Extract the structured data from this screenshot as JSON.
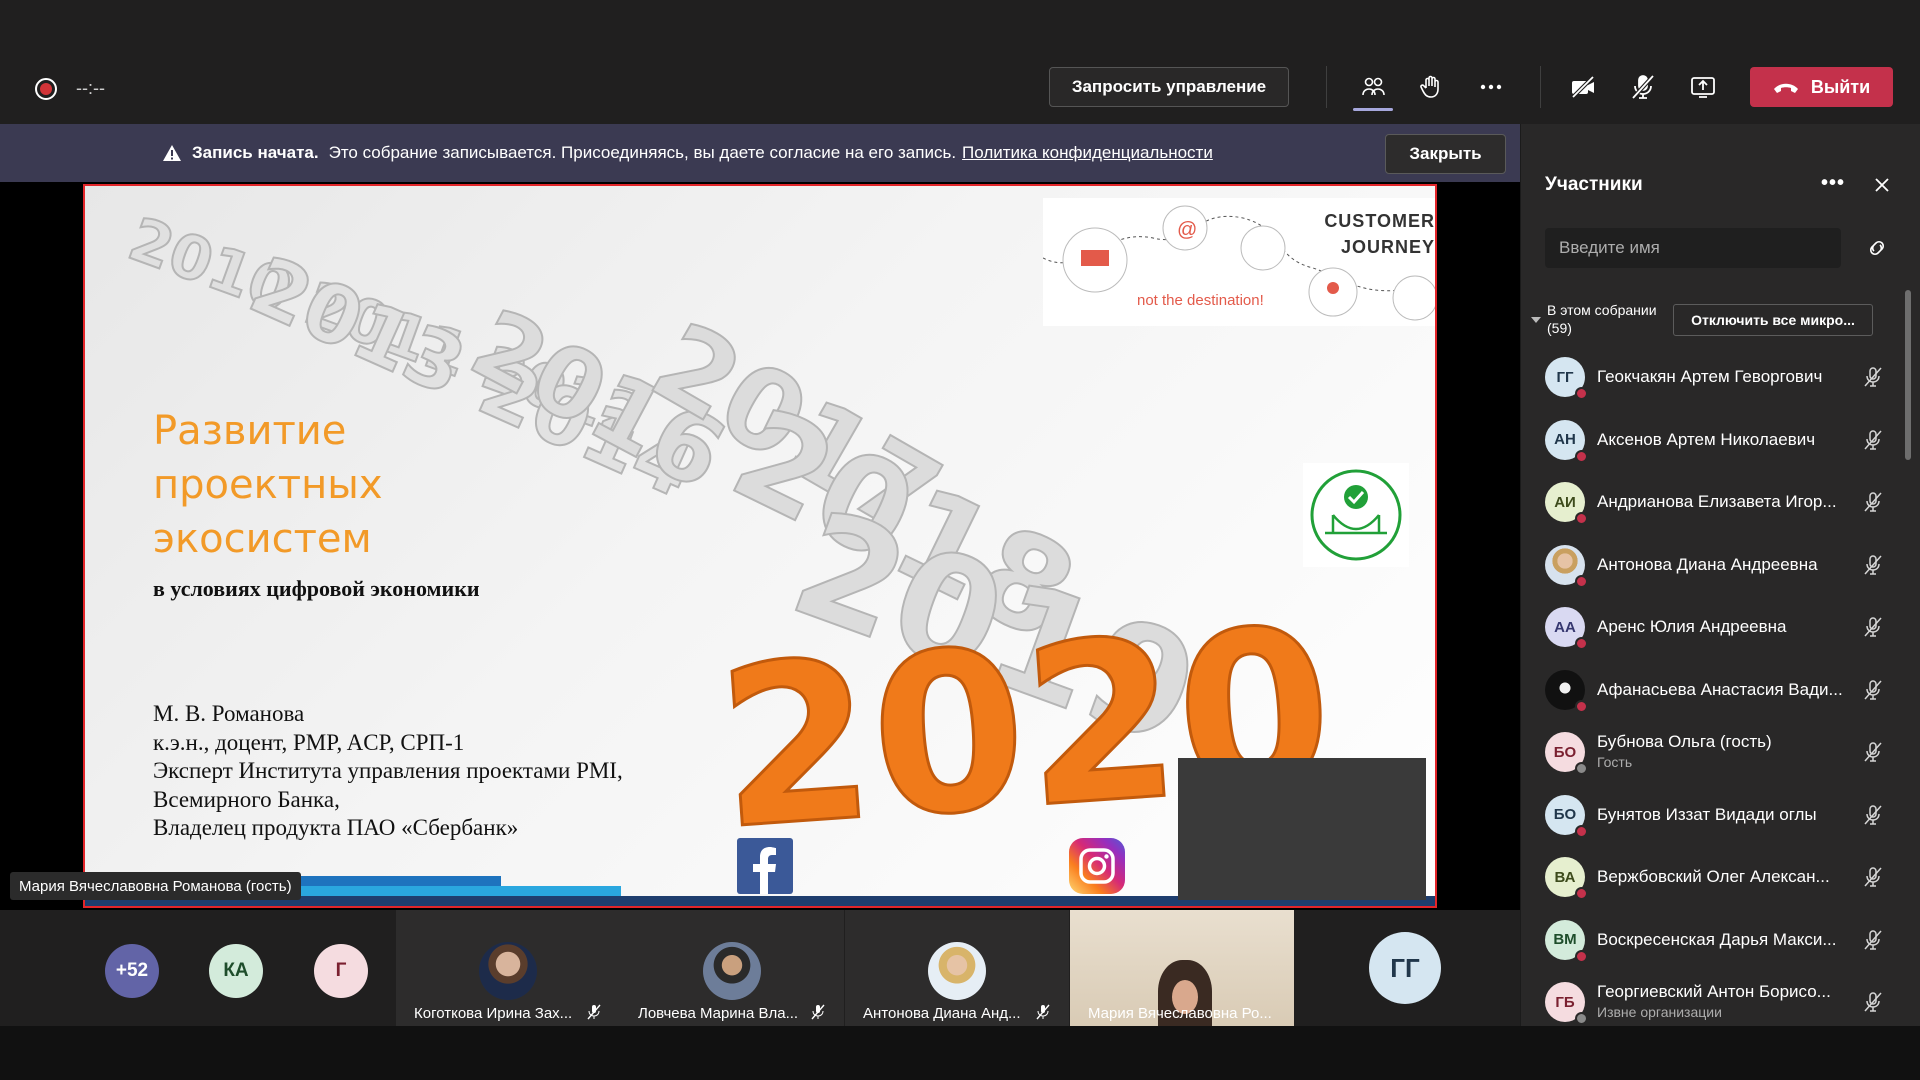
{
  "topbar": {
    "timer": "--:--",
    "request_control_label": "Запросить управление",
    "leave_label": "Выйти"
  },
  "banner": {
    "bold": "Запись начата.",
    "text": "Это собрание записывается. Присоединяясь, вы даете согласие на его запись.",
    "link": "Политика конфиденциальности",
    "close_label": "Закрыть"
  },
  "slide": {
    "title": "Развитие проектных экосистем",
    "subtitle": "в условиях цифровой экономики",
    "author_lines": "М. В. Романова\nк.э.н., доцент, PMP, ACP, СРП-1\nЭксперт Института управления проектами PMI,\nВсемирного Банка,\nВладелец продукта ПАО «Сбербанк»",
    "cj_title_1": "CUSTOMER",
    "cj_title_2": "JOURNEY",
    "cj_sub": "not the destination!",
    "years": [
      "2020",
      "2019",
      "2018",
      "2017",
      "2016"
    ]
  },
  "presenter_label": "Мария Вячеславовна Романова (гость)",
  "strip": {
    "bubbles": [
      {
        "label": "+52",
        "bg": "#6264a7",
        "fg": "#ffffff"
      },
      {
        "label": "КА",
        "bg": "#d3ebdb",
        "fg": "#1e4d2b"
      },
      {
        "label": "Г",
        "bg": "#f5dce0",
        "fg": "#7a2030"
      }
    ],
    "tiles": [
      {
        "name": "Коготкова Ирина Зах..."
      },
      {
        "name": "Ловчева Марина Вла..."
      },
      {
        "name": "Антонова Диана Анд..."
      }
    ],
    "video_name": "Мария Вячеславовна Ро...",
    "gg_label": "ГГ"
  },
  "panel": {
    "title": "Участники",
    "search_placeholder": "Введите имя",
    "section_label": "В этом собрании (59)",
    "mute_all_label": "Отключить все микро...",
    "participants": [
      {
        "initials": "ГГ",
        "name": "Геокчакян Артем Геворгович",
        "sub": "",
        "bg": "#d5e6f1",
        "fg": "#21374b",
        "status": "#c4314b"
      },
      {
        "initials": "АН",
        "name": "Аксенов Артем Николаевич",
        "sub": "",
        "bg": "#d5e6f1",
        "fg": "#21374b",
        "status": "#c4314b"
      },
      {
        "initials": "АИ",
        "name": "Андрианова Елизавета Игор...",
        "sub": "",
        "bg": "#e6efcf",
        "fg": "#3d4b1c",
        "status": "#c4314b"
      },
      {
        "initials": "",
        "name": "Антонова Диана Андреевна",
        "sub": "",
        "bg": "#c9d4e3",
        "fg": "#21374b",
        "status": "#c4314b",
        "photo": true
      },
      {
        "initials": "АА",
        "name": "Аренс Юлия Андреевна",
        "sub": "",
        "bg": "#d9d9f2",
        "fg": "#363770",
        "status": "#c4314b"
      },
      {
        "initials": "",
        "name": "Афанасьева Анастасия Вади...",
        "sub": "",
        "bg": "#111111",
        "fg": "#ffffff",
        "status": "#c4314b",
        "photo": true
      },
      {
        "initials": "БО",
        "name": "Бубнова Ольга (гость)",
        "sub": "Гость",
        "bg": "#f5dce0",
        "fg": "#7a2030",
        "status": "#8a8a8a"
      },
      {
        "initials": "БО",
        "name": "Бунятов Иззат Видади оглы",
        "sub": "",
        "bg": "#d5e6f1",
        "fg": "#21374b",
        "status": "#c4314b"
      },
      {
        "initials": "ВА",
        "name": "Вержбовский Олег Алексан...",
        "sub": "",
        "bg": "#e6efcf",
        "fg": "#3d4b1c",
        "status": "#c4314b"
      },
      {
        "initials": "ВМ",
        "name": "Воскресенская Дарья Макси...",
        "sub": "",
        "bg": "#d3ebdb",
        "fg": "#1e4d2b",
        "status": "#c4314b"
      },
      {
        "initials": "ГБ",
        "name": "Георгиевский Антон Борисо...",
        "sub": "Извне организации",
        "bg": "#f5dce0",
        "fg": "#7a2030",
        "status": "#8a8a8a"
      }
    ]
  },
  "colors": {
    "accent": "#6264a7",
    "leave": "#c4314b",
    "slide_orange": "#f29a28",
    "slide_border": "#e3262a"
  }
}
